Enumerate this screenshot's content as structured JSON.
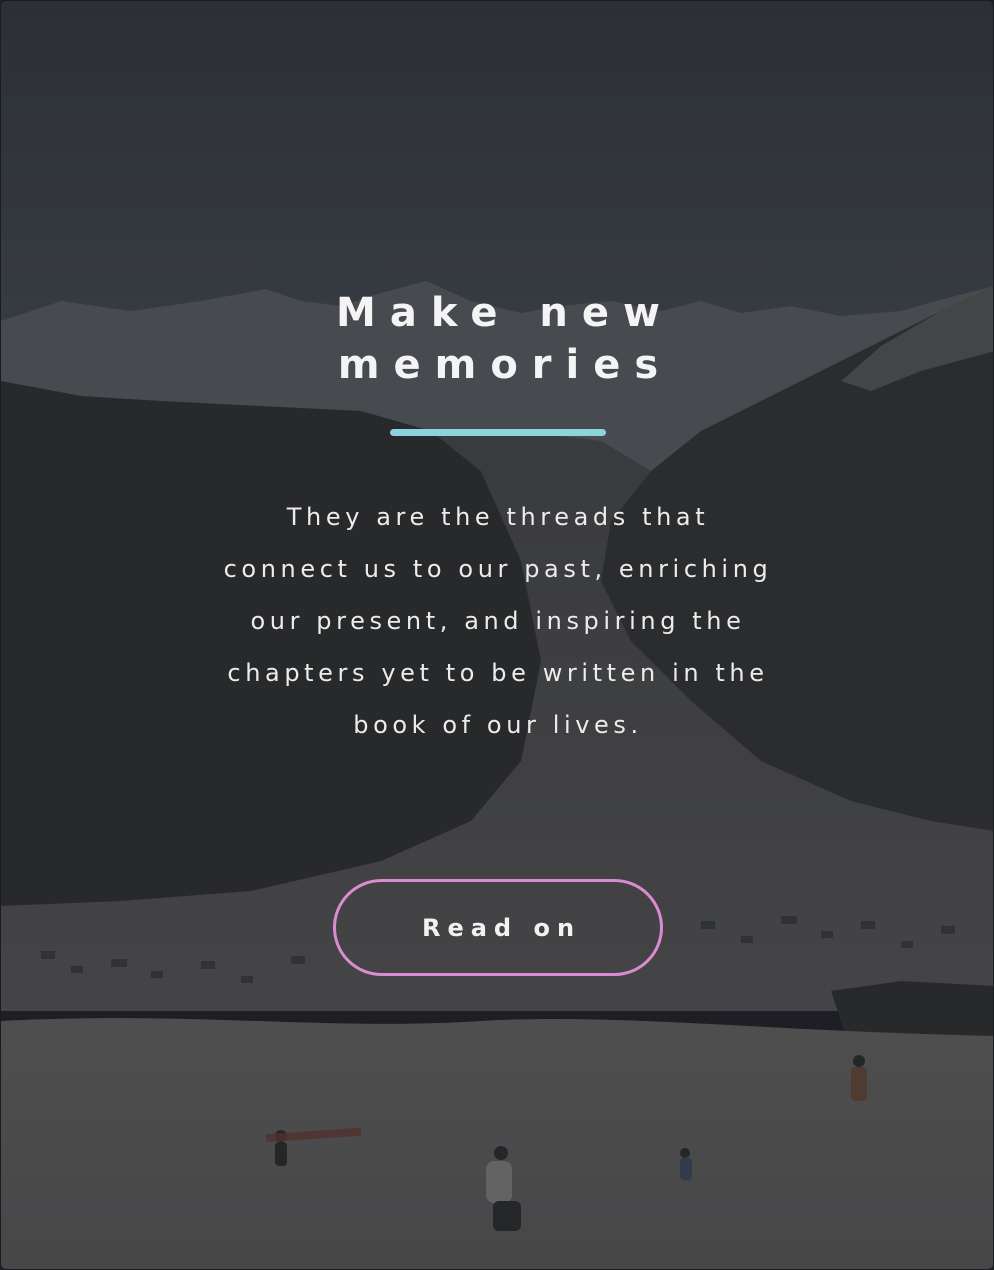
{
  "hero": {
    "title_line1": "Make new",
    "title_line2": "memories",
    "body": "They are the threads that connect us to our past, enriching our present, and inspiring the chapters yet to be written in the book of our lives.",
    "button_label": "Read on"
  },
  "colors": {
    "accent_underline": "#8dd3dc",
    "button_border": "#d98ccf",
    "text": "#f4f4f4",
    "overlay": "#1e2024"
  }
}
